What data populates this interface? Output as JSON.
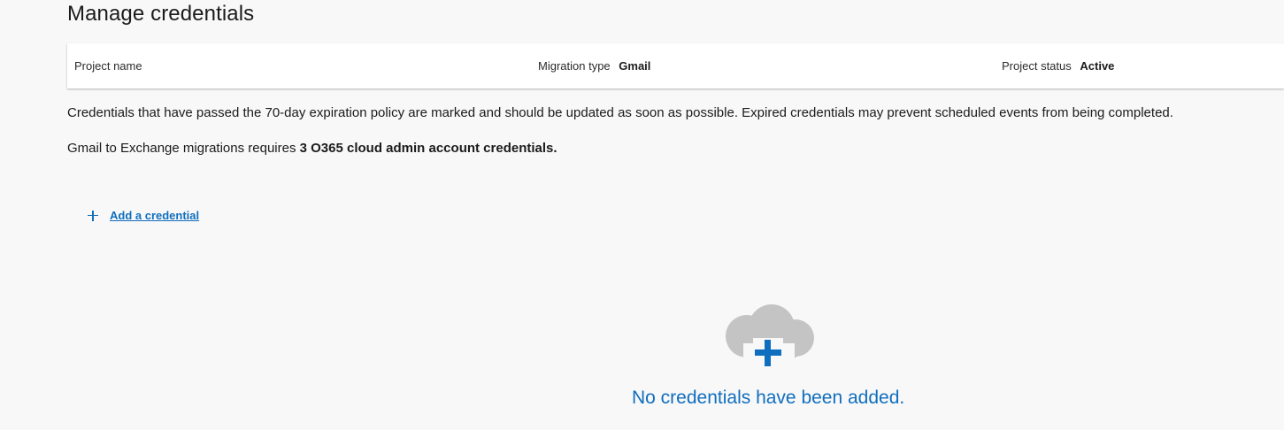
{
  "page": {
    "title": "Manage credentials"
  },
  "project_info": {
    "name_label": "Project name",
    "name_value": "",
    "type_label": "Migration type",
    "type_value": "Gmail",
    "status_label": "Project status",
    "status_value": "Active"
  },
  "notices": {
    "expiration": "Credentials that have passed the 70-day expiration policy are marked and should be updated as soon as possible. Expired credentials may prevent scheduled events from being completed.",
    "requirement_prefix": "Gmail to Exchange migrations requires ",
    "requirement_bold": "3 O365 cloud admin account credentials."
  },
  "actions": {
    "add_credential": "Add a credential",
    "add_icon": "plus-icon"
  },
  "empty_state": {
    "icon": "cloud-add-icon",
    "message": "No credentials have been added."
  },
  "colors": {
    "accent": "#106ebe",
    "cloud": "#c4c4c4",
    "background": "#f8f8f8"
  }
}
